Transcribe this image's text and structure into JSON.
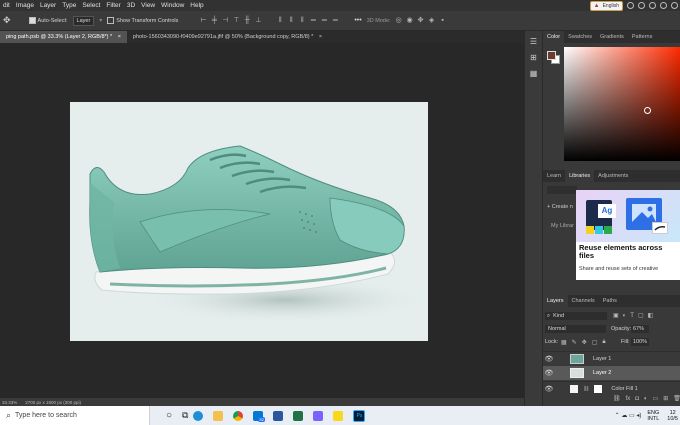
{
  "menu": [
    "dit",
    "Image",
    "Layer",
    "Type",
    "Select",
    "Filter",
    "3D",
    "View",
    "Window",
    "Help"
  ],
  "title_widgets": {
    "language_label": "English"
  },
  "options_bar": {
    "auto_select_label": "Auto-Select:",
    "auto_select_value": "Layer",
    "show_transform_label": "Show Transform Controls",
    "more_label": "•••",
    "mode_label": "3D Mode:"
  },
  "tabs": [
    {
      "label": "ping path.psb @ 33.3% (Layer 2, RGB/8*) *",
      "close": "×"
    },
    {
      "label": "photo-1560343090-f0409e92791a.jfif @ 50% (Background copy, RGB/8) *",
      "close": "×"
    }
  ],
  "status": {
    "zoom": "33.33%",
    "size": "2700 px x 1800 px (300 ppi)"
  },
  "color_panel": {
    "tabs": [
      "Color",
      "Swatches",
      "Gradients",
      "Patterns"
    ],
    "active_tab": "Color",
    "foreground": "#6b3a32",
    "background": "#ffffff"
  },
  "libraries_panel": {
    "tabs": [
      "Learn",
      "Libraries",
      "Adjustments"
    ],
    "active_tab": "Libraries",
    "create_label": "+ Create n",
    "mylib_label": "My Librar",
    "promo_title": "Reuse elements across files",
    "promo_body": "Share and reuse sets of creative",
    "promo_badge": "Ag"
  },
  "layers_panel": {
    "tabs": [
      "Layers",
      "Channels",
      "Paths"
    ],
    "active_tab": "Layers",
    "filter_label": "Kind",
    "blend_mode": "Normal",
    "opacity_label": "Opacity:",
    "opacity_value": "67%",
    "lock_label": "Lock:",
    "fill_label": "Fill:",
    "fill_value": "100%",
    "layers": [
      {
        "name": "Layer 1",
        "visible": true,
        "selected": false
      },
      {
        "name": "Layer 2",
        "visible": true,
        "selected": true
      },
      {
        "name": "Color Fill 1",
        "visible": true,
        "selected": false
      }
    ]
  },
  "taskbar": {
    "search_placeholder": "Type here to search",
    "badge_count": "52",
    "lang_top": "ENG",
    "lang_bottom": "INTL",
    "time": "12",
    "date": "10/5"
  }
}
